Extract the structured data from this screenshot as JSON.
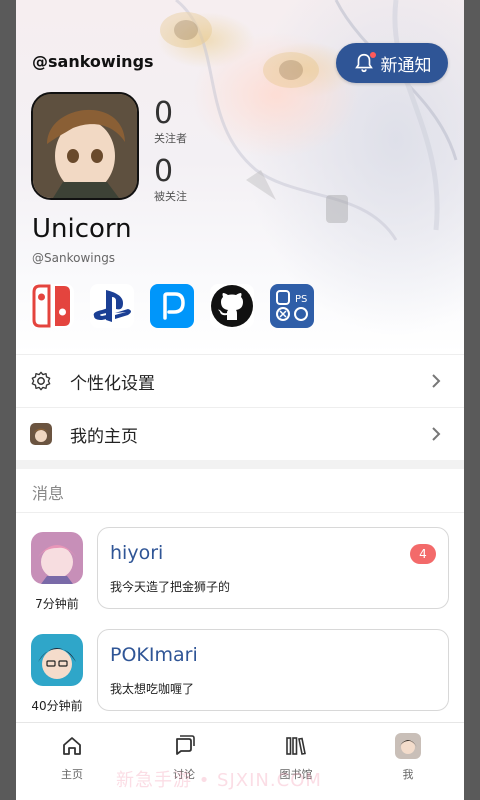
{
  "header": {
    "username": "@sankowings",
    "notify_label": "新通知"
  },
  "profile": {
    "following_count": "0",
    "following_label": "关注者",
    "followers_count": "0",
    "followers_label": "被关注",
    "display_name": "Unicorn",
    "handle": "@Sankowings",
    "platforms": [
      "nintendo-switch-icon",
      "playstation-icon",
      "pixiv-icon",
      "github-icon",
      "multi-platform-icon"
    ]
  },
  "menu": {
    "settings_label": "个性化设置",
    "homepage_label": "我的主页"
  },
  "messages": {
    "section_title": "消息",
    "items": [
      {
        "name": "hiyori",
        "text": "我今天造了把金狮子的",
        "time": "7分钟前",
        "badge": "4"
      },
      {
        "name": "POKImari",
        "text": "我太想吃咖喱了",
        "time": "40分钟前"
      }
    ]
  },
  "tabbar": {
    "tabs": [
      {
        "label": "主页"
      },
      {
        "label": "讨论"
      },
      {
        "label": "图书馆"
      },
      {
        "label": "我"
      }
    ]
  },
  "watermark": "新急手游 • SJXIN.COM"
}
